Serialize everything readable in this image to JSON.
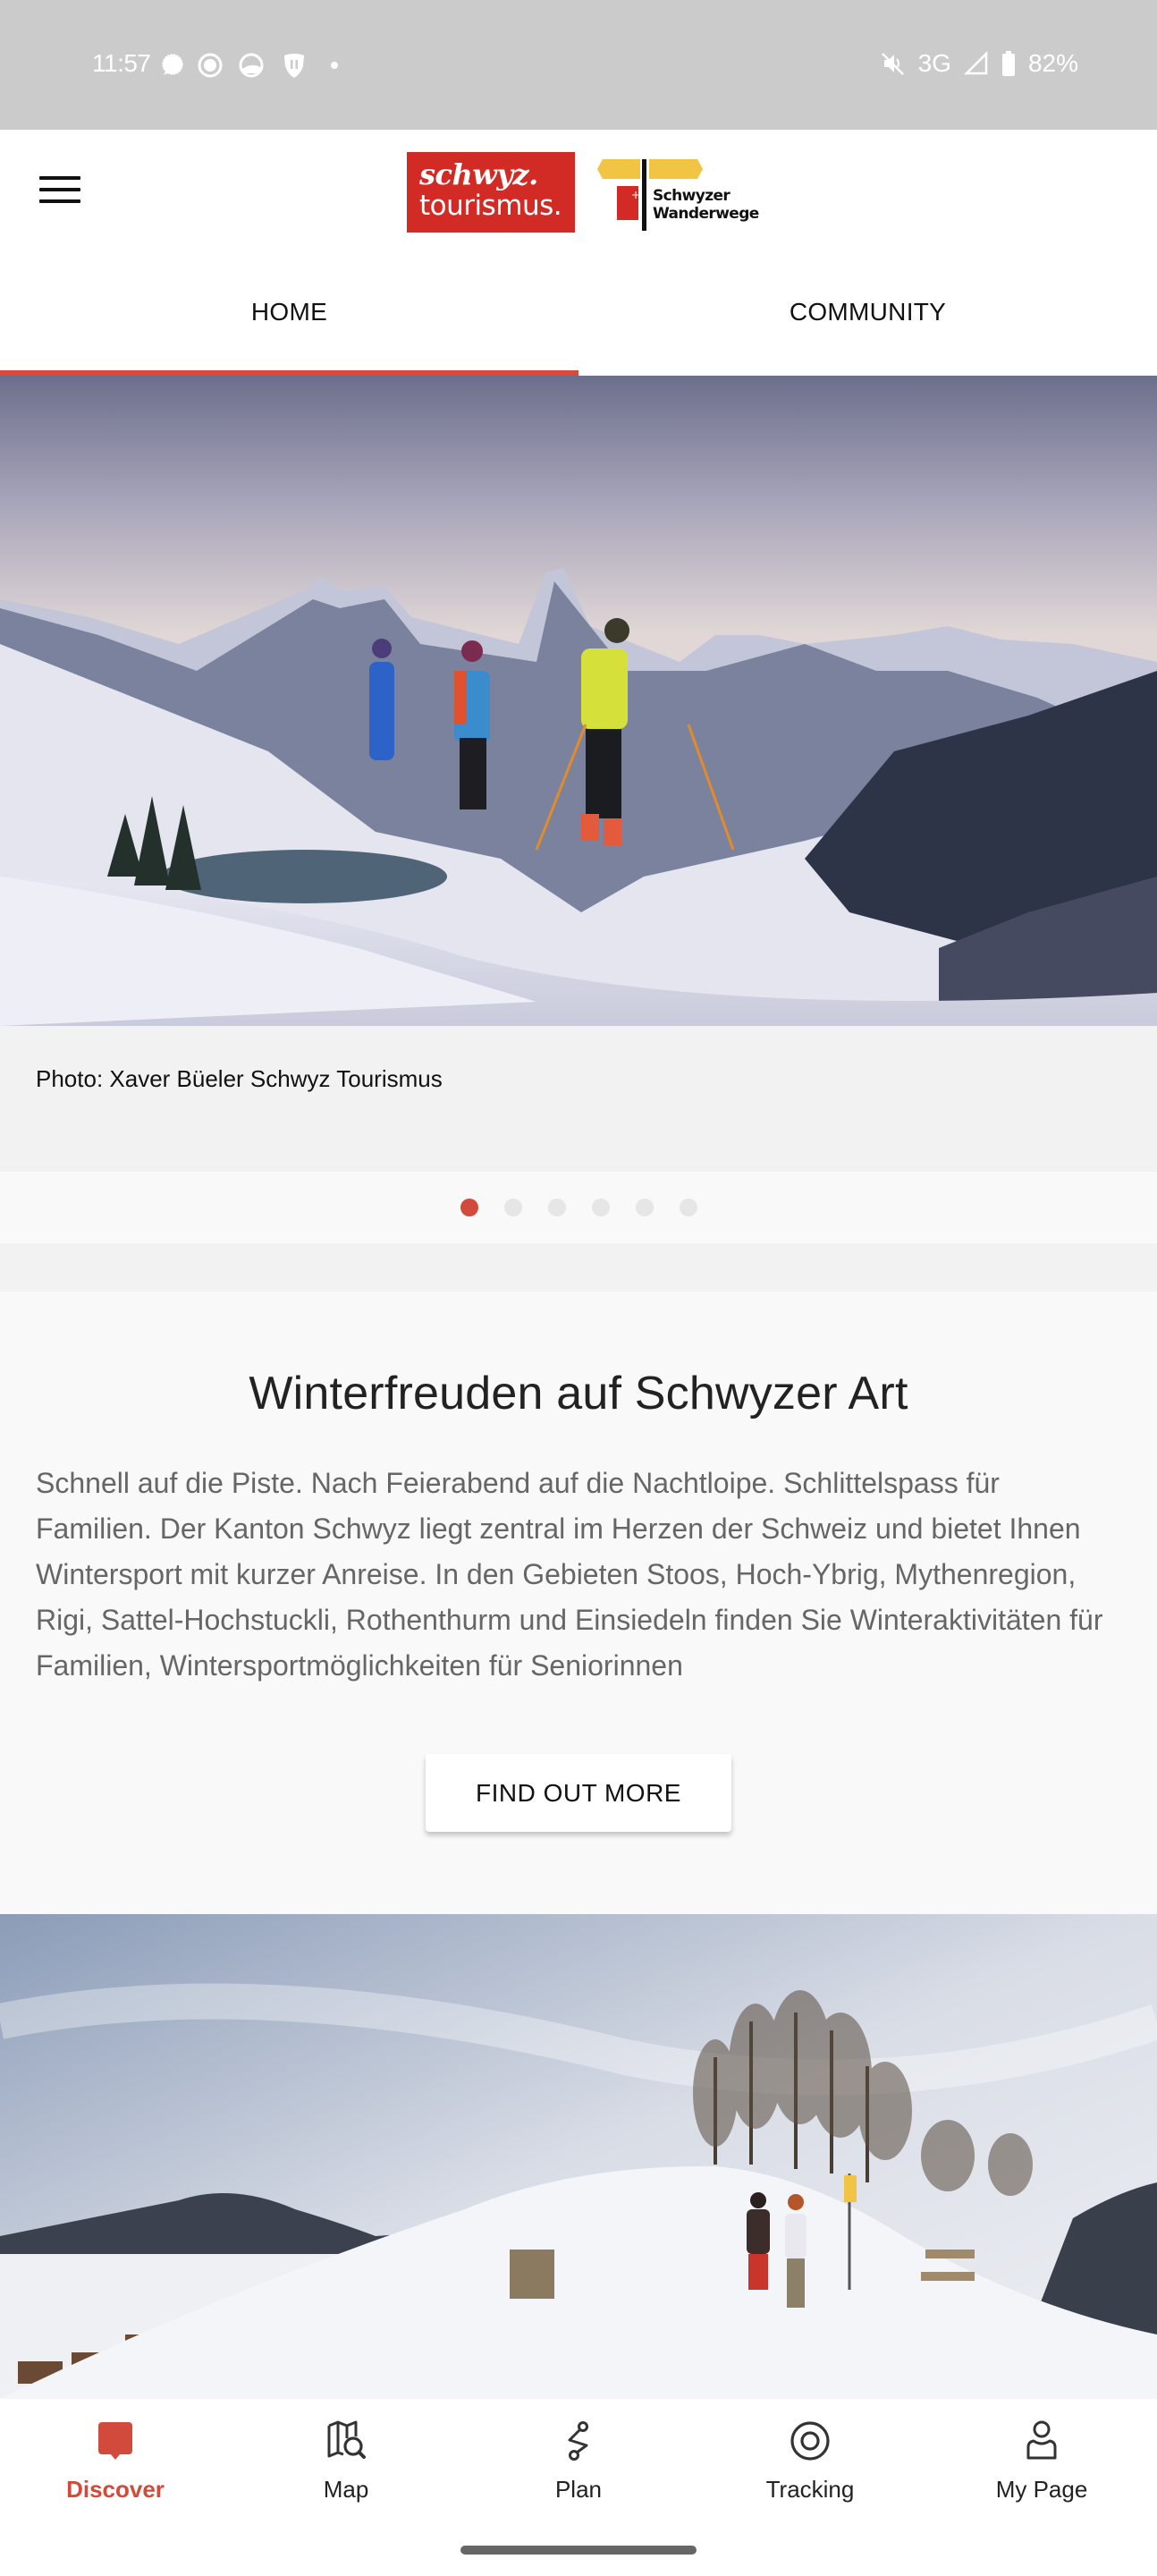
{
  "status_bar": {
    "time": "11:57",
    "left_icons": [
      "signal-messenger-icon",
      "app-notification-icon",
      "app-notification-icon-2",
      "shield-icon",
      "more-notifications-dot-icon"
    ],
    "network": "3G",
    "battery": "82%",
    "right_icons": [
      "mute-icon",
      "cell-signal-icon",
      "battery-icon"
    ]
  },
  "header": {
    "menu_icon": "hamburger-menu-icon",
    "logo_primary_line1": "schwyz.",
    "logo_primary_line2": "tourismus.",
    "logo_secondary_line1": "Schwyzer",
    "logo_secondary_line2": "Wanderwege"
  },
  "tabs": [
    {
      "label": "HOME",
      "active": true
    },
    {
      "label": "COMMUNITY",
      "active": false
    }
  ],
  "hero": {
    "image_description": "Three ski tourers ascending a snowy ridge with mountains and a lake behind",
    "caption": "Photo: Xaver Büeler Schwyz Tourismus",
    "pager": {
      "count": 6,
      "active_index": 0
    }
  },
  "article": {
    "title": "Winterfreuden auf Schwyzer Art",
    "body": "Schnell auf die Piste. Nach Feierabend auf die Nachtloipe. Schlittelspass für Familien. Der Kanton Schwyz liegt zentral im Herzen der Schweiz und bietet Ihnen Wintersport mit kurzer Anreise. In den Gebieten Stoos, Hoch-Ybrig, Mythenregion, Rigi, Sattel-Hochstuckli, Rothenthurm und Einsiedeln finden Sie Winteraktivitäten für Familien, Wintersportmöglichkeiten für Seniorinnen",
    "button_label": "FIND OUT MORE"
  },
  "second_image": {
    "image_description": "Two hikers on a snowy hilltop next to a signpost, bench and bare trees, village in the valley"
  },
  "bottom_nav": [
    {
      "label": "Discover",
      "icon": "discover-icon",
      "active": true
    },
    {
      "label": "Map",
      "icon": "map-search-icon",
      "active": false
    },
    {
      "label": "Plan",
      "icon": "route-plan-icon",
      "active": false
    },
    {
      "label": "Tracking",
      "icon": "tracking-target-icon",
      "active": false
    },
    {
      "label": "My Page",
      "icon": "user-profile-icon",
      "active": false
    }
  ],
  "colors": {
    "accent": "#d24a3c",
    "brand_red": "#d22b26",
    "brand_yellow": "#f2c443",
    "status_bar_bg": "#cbcbcb",
    "body_text": "#666666"
  }
}
